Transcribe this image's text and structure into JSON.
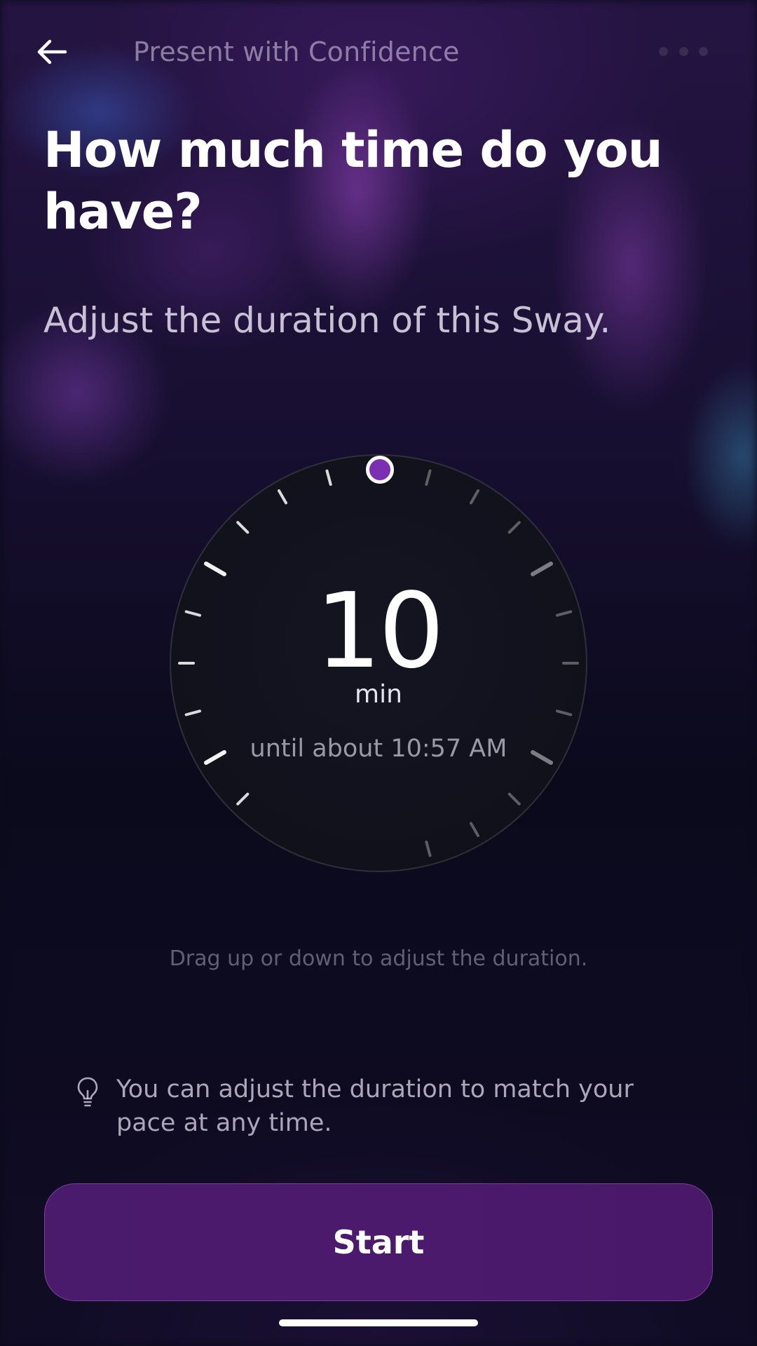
{
  "nav": {
    "back_icon": "arrow-left-icon",
    "title": "Present with Confidence",
    "more_icon": "more-dots-icon"
  },
  "heading": "How much time do you have?",
  "subheading": "Adjust the duration of this Sway.",
  "dial": {
    "value": "10",
    "unit": "min",
    "until_text": "until about 10:57 AM",
    "knob_color": "#7d2fb1"
  },
  "hint": "Drag up or down to adjust the duration.",
  "tip": {
    "icon": "lightbulb-icon",
    "text": "You can adjust the duration to match your pace at any time."
  },
  "start_button": {
    "label": "Start",
    "color": "#4a1a6c"
  }
}
